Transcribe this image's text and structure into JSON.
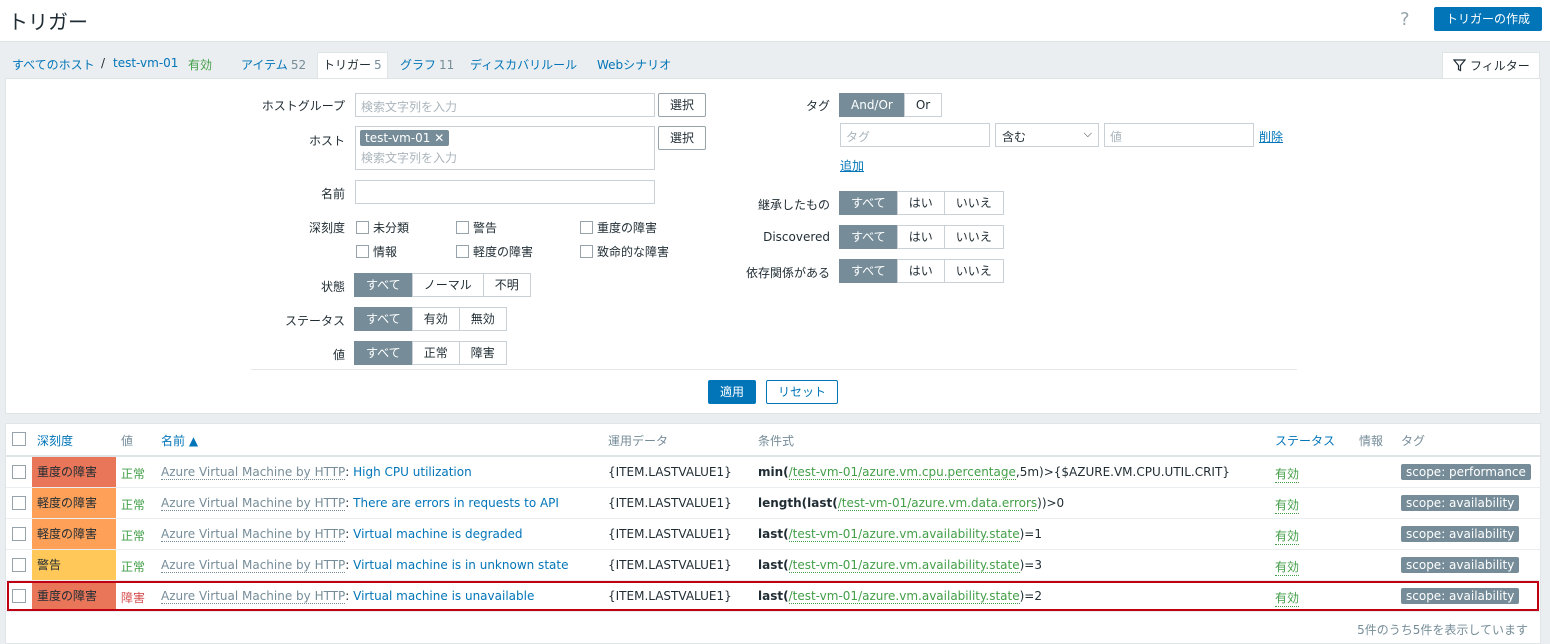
{
  "header": {
    "title": "トリガー",
    "help": "?",
    "create_button": "トリガーの作成"
  },
  "nav": {
    "all_hosts": "すべてのホスト",
    "separator": "/",
    "host": "test-vm-01",
    "host_status": "有効",
    "items": {
      "label": "アイテム",
      "count": "52"
    },
    "triggers": {
      "label": "トリガー",
      "count": "5"
    },
    "graphs": {
      "label": "グラフ",
      "count": "11"
    },
    "discovery": "ディスカバリルール",
    "web": "Webシナリオ",
    "filter_tab": "フィルター"
  },
  "filter": {
    "host_group": {
      "label": "ホストグループ",
      "placeholder": "検索文字列を入力",
      "select": "選択"
    },
    "host": {
      "label": "ホスト",
      "chip": "test-vm-01",
      "placeholder": "検索文字列を入力",
      "select": "選択"
    },
    "name": {
      "label": "名前",
      "value": ""
    },
    "severity": {
      "label": "深刻度",
      "options": [
        "未分類",
        "警告",
        "重度の障害",
        "情報",
        "軽度の障害",
        "致命的な障害"
      ]
    },
    "state": {
      "label": "状態",
      "options": [
        "すべて",
        "ノーマル",
        "不明"
      ],
      "selected": "すべて"
    },
    "status": {
      "label": "ステータス",
      "options": [
        "すべて",
        "有効",
        "無効"
      ],
      "selected": "すべて"
    },
    "value": {
      "label": "値",
      "options": [
        "すべて",
        "正常",
        "障害"
      ],
      "selected": "すべて"
    },
    "tags": {
      "label": "タグ",
      "options": [
        "And/Or",
        "Or"
      ],
      "selected": "And/Or",
      "tag_placeholder": "タグ",
      "operator": "含む",
      "value_placeholder": "値",
      "remove": "削除",
      "add": "追加"
    },
    "inherited": {
      "label": "継承したもの",
      "options": [
        "すべて",
        "はい",
        "いいえ"
      ],
      "selected": "すべて"
    },
    "discovered": {
      "label": "Discovered",
      "options": [
        "すべて",
        "はい",
        "いいえ"
      ],
      "selected": "すべて"
    },
    "dependencies": {
      "label": "依存関係がある",
      "options": [
        "すべて",
        "はい",
        "いいえ"
      ],
      "selected": "すべて"
    },
    "apply": "適用",
    "reset": "リセット"
  },
  "table": {
    "columns": {
      "severity": "深刻度",
      "value": "値",
      "name": "名前 ▲",
      "opdata": "運用データ",
      "expression": "条件式",
      "status": "ステータス",
      "info": "情報",
      "tags": "タグ"
    },
    "rows": [
      {
        "severity": "重度の障害",
        "sev_color": "#e97659",
        "value": "正常",
        "value_color": "#429e47",
        "template": "Azure Virtual Machine by HTTP",
        "name": "High CPU utilization",
        "opdata": "{ITEM.LASTVALUE1}",
        "fn": "min(",
        "item": "/test-vm-01/azure.vm.cpu.percentage",
        "rest": ",5m)>{$AZURE.VM.CPU.UTIL.CRIT}",
        "status": "有効",
        "tag": "scope: performance"
      },
      {
        "severity": "軽度の障害",
        "sev_color": "#ffa059",
        "value": "正常",
        "value_color": "#429e47",
        "template": "Azure Virtual Machine by HTTP",
        "name": "There are errors in requests to API",
        "opdata": "{ITEM.LASTVALUE1}",
        "fn": "length(last(",
        "item": "/test-vm-01/azure.vm.data.errors",
        "rest": "))>0",
        "status": "有効",
        "tag": "scope: availability"
      },
      {
        "severity": "軽度の障害",
        "sev_color": "#ffa059",
        "value": "正常",
        "value_color": "#429e47",
        "template": "Azure Virtual Machine by HTTP",
        "name": "Virtual machine is degraded",
        "opdata": "{ITEM.LASTVALUE1}",
        "fn": "last(",
        "item": "/test-vm-01/azure.vm.availability.state",
        "rest": ")=1",
        "status": "有効",
        "tag": "scope: availability"
      },
      {
        "severity": "警告",
        "sev_color": "#ffc859",
        "value": "正常",
        "value_color": "#429e47",
        "template": "Azure Virtual Machine by HTTP",
        "name": "Virtual machine is in unknown state",
        "opdata": "{ITEM.LASTVALUE1}",
        "fn": "last(",
        "item": "/test-vm-01/azure.vm.availability.state",
        "rest": ")=3",
        "status": "有効",
        "tag": "scope: availability"
      },
      {
        "severity": "重度の障害",
        "sev_color": "#e97659",
        "value": "障害",
        "value_color": "#d64e4e",
        "template": "Azure Virtual Machine by HTTP",
        "name": "Virtual machine is unavailable",
        "opdata": "{ITEM.LASTVALUE1}",
        "fn": "last(",
        "item": "/test-vm-01/azure.vm.availability.state",
        "rest": ")=2",
        "status": "有効",
        "tag": "scope: availability"
      }
    ],
    "footer": "5件のうち5件を表示しています"
  }
}
